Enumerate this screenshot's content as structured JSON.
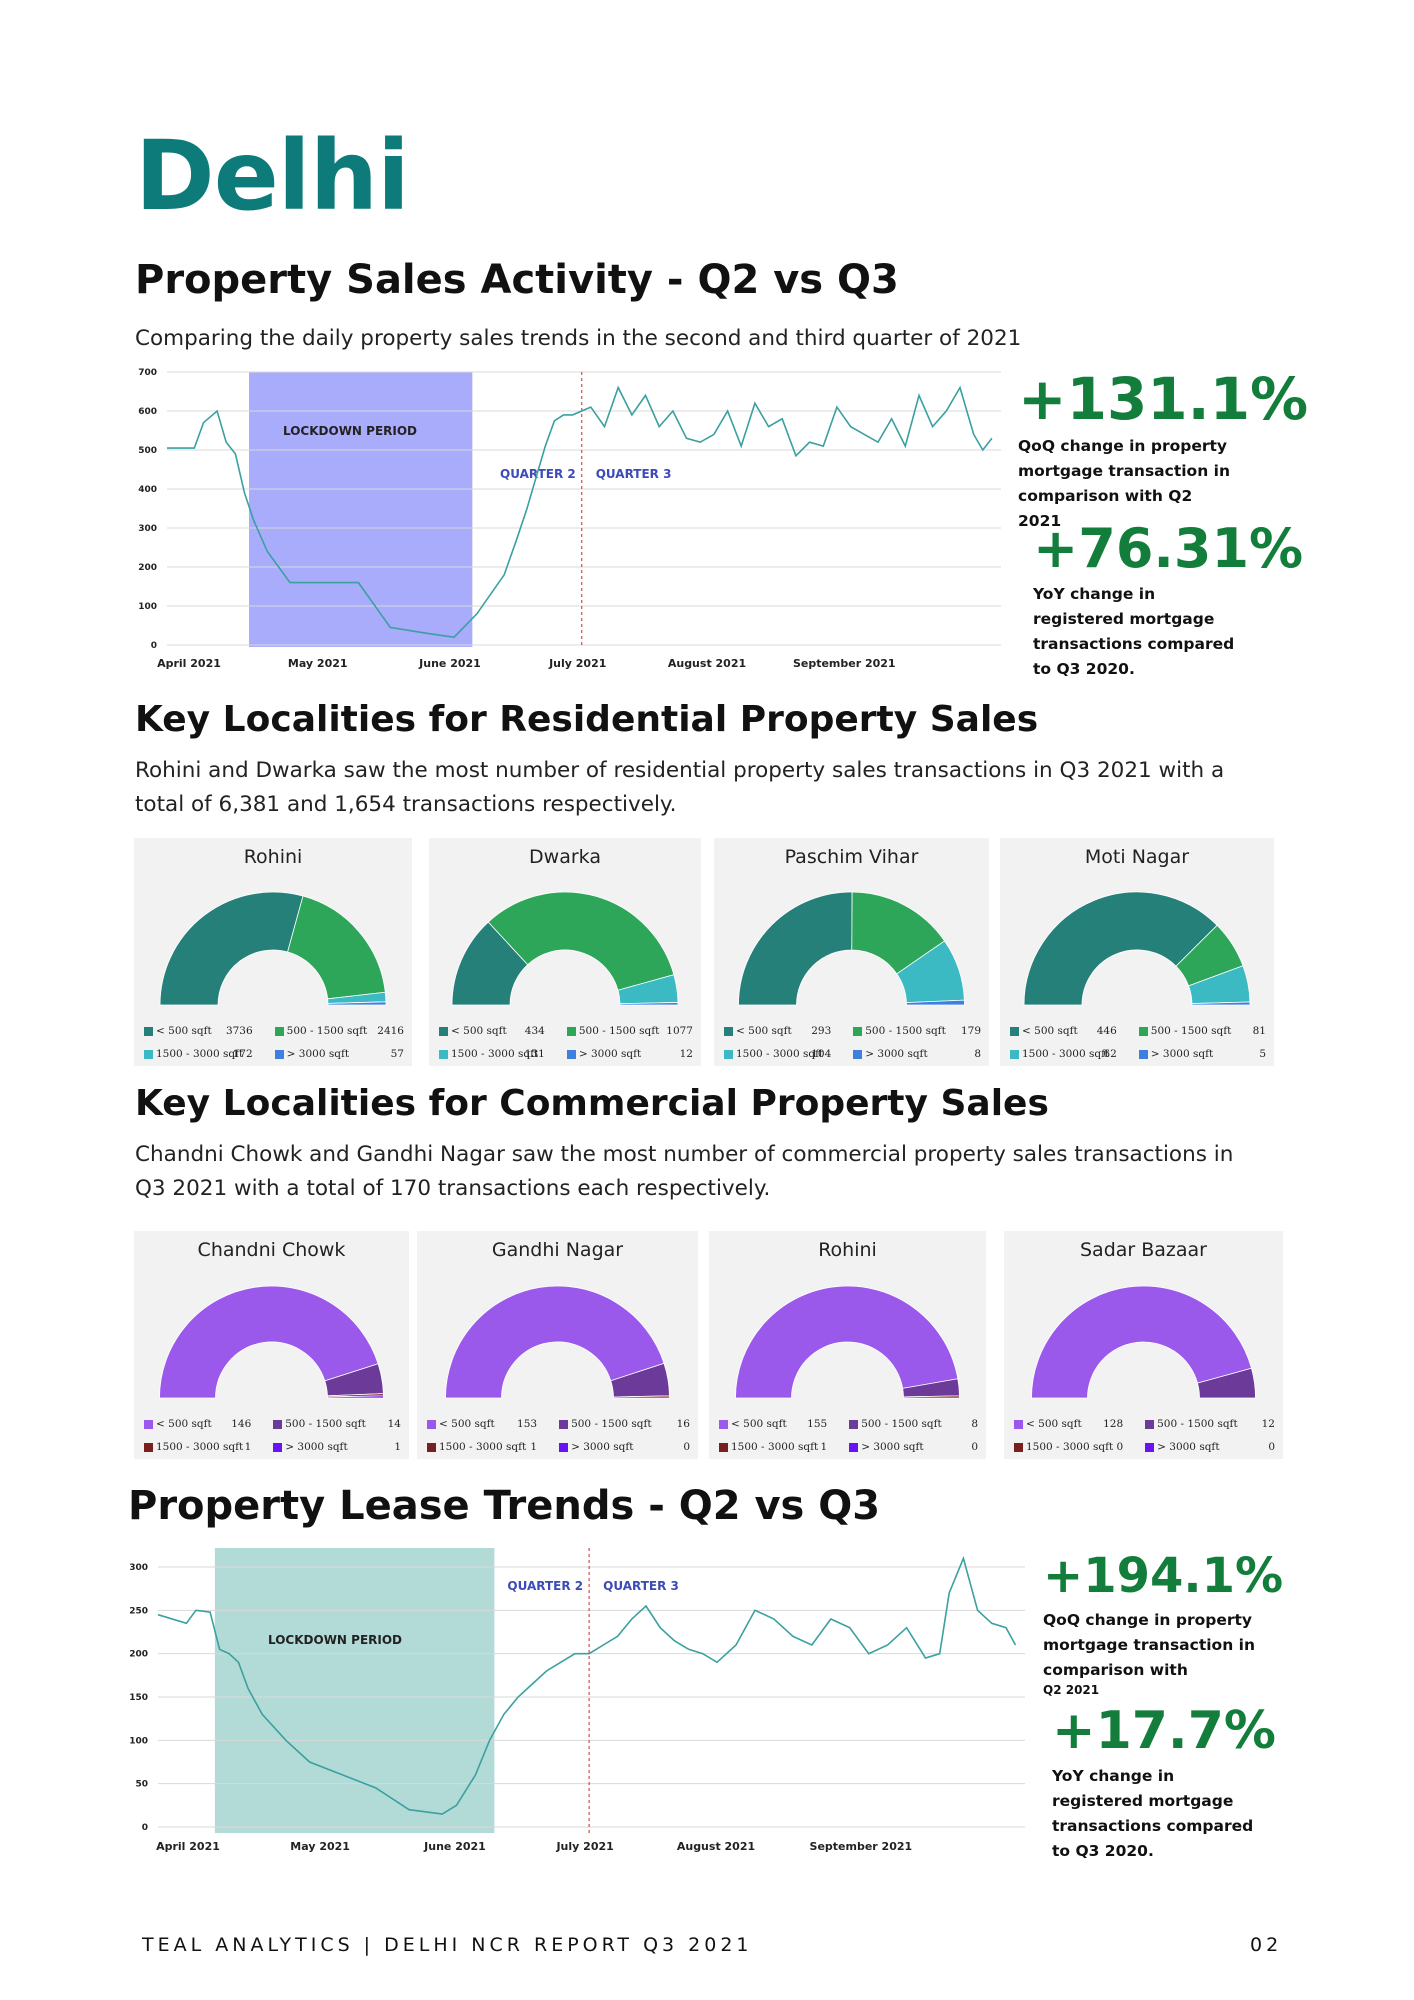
{
  "page": {
    "city": "Delhi",
    "footer_left": "TEAL ANALYTICS | DELHI NCR REPORT Q3 2021",
    "footer_right": "02"
  },
  "sales": {
    "heading": "Property Sales Activity - Q2 vs Q3",
    "subtitle": "Comparing the daily property sales trends in the second and third quarter of 2021",
    "stat1": {
      "value": "+131.1%",
      "text": "QoQ change in property mortgage transaction in comparison with Q2 2021"
    },
    "stat2": {
      "value": "+76.31%",
      "text": "YoY change in registered mortgage transactions compared to Q3 2020."
    }
  },
  "residential": {
    "heading": "Key Localities for Residential Property Sales",
    "text": "Rohini and Dwarka saw the most number of residential property sales transactions in Q3 2021 with a total of 6,381 and 1,654 transactions respectively."
  },
  "commercial": {
    "heading": "Key Localities for Commercial Property Sales",
    "text": "Chandni Chowk and Gandhi Nagar saw the most number of commercial property sales transactions in Q3 2021 with a total of 170 transactions each respectively."
  },
  "lease": {
    "heading": "Property Lease Trends - Q2 vs Q3",
    "stat1": {
      "value": "+194.1%",
      "text": "QoQ change in property mortgage transaction in comparison with",
      "text_small": "Q2 2021"
    },
    "stat2": {
      "value": "+17.7%",
      "text": "YoY change in registered mortgage transactions compared to Q3 2020."
    }
  },
  "legend_labels": {
    "a": "< 500 sqft",
    "b": "500 - 1500 sqft",
    "c": "1500 - 3000 sqft",
    "d": "> 3000 sqft"
  },
  "colors": {
    "teal_title": "#0d7b7a",
    "stat_green": "#137d3b",
    "res": [
      "#25807a",
      "#2ea65a",
      "#3bbac4",
      "#3f7fe0"
    ],
    "com": [
      "#9b59ec",
      "#6c3a99",
      "#7a1f1f",
      "#6a13f2"
    ],
    "sales_line": "#3aa0a0",
    "sales_lockdown": "#a9abfb",
    "lease_lockdown": "#b2dbd7"
  },
  "chart_data": [
    {
      "type": "line",
      "title": "",
      "x_tick_labels": [
        "April 2021",
        "May  2021",
        "June 2021",
        "July 2021",
        "August 2021",
        "September 2021"
      ],
      "ylim": [
        0,
        700
      ],
      "y_ticks": [
        0,
        100,
        200,
        300,
        400,
        500,
        600,
        700
      ],
      "annotations": [
        "LOCKDOWN PERIOD",
        "QUARTER 2",
        "QUARTER 3"
      ],
      "shaded_period": {
        "label": "LOCKDOWN PERIOD",
        "start": "2021-04-19",
        "end": "2021-06-07"
      },
      "quarter_divider": "2021-07-01",
      "series": [
        {
          "x": [
            "2021-04-01",
            "2021-04-07",
            "2021-04-09",
            "2021-04-12",
            "2021-04-14",
            "2021-04-16",
            "2021-04-18",
            "2021-04-20",
            "2021-04-23",
            "2021-04-28",
            "2021-05-03",
            "2021-05-07",
            "2021-05-13",
            "2021-05-20",
            "2021-05-28",
            "2021-05-31",
            "2021-06-03",
            "2021-06-08",
            "2021-06-14",
            "2021-06-17",
            "2021-06-19",
            "2021-06-21",
            "2021-06-23",
            "2021-06-25",
            "2021-06-27",
            "2021-06-29",
            "2021-07-01",
            "2021-07-03",
            "2021-07-06",
            "2021-07-09",
            "2021-07-12",
            "2021-07-15",
            "2021-07-18",
            "2021-07-21",
            "2021-07-24",
            "2021-07-27",
            "2021-07-30",
            "2021-08-02",
            "2021-08-05",
            "2021-08-08",
            "2021-08-11",
            "2021-08-14",
            "2021-08-17",
            "2021-08-20",
            "2021-08-23",
            "2021-08-26",
            "2021-08-29",
            "2021-09-01",
            "2021-09-04",
            "2021-09-07",
            "2021-09-10",
            "2021-09-13",
            "2021-09-16",
            "2021-09-19",
            "2021-09-22",
            "2021-09-25",
            "2021-09-27",
            "2021-09-29"
          ],
          "y": [
            505,
            505,
            570,
            600,
            520,
            490,
            390,
            320,
            240,
            160,
            160,
            160,
            160,
            45,
            30,
            25,
            20,
            80,
            180,
            280,
            350,
            430,
            510,
            575,
            590,
            590,
            600,
            610,
            560,
            660,
            590,
            640,
            560,
            600,
            530,
            520,
            540,
            600,
            510,
            620,
            560,
            580,
            485,
            520,
            510,
            610,
            560,
            540,
            520,
            580,
            510,
            640,
            560,
            600,
            660,
            540,
            500,
            530
          ]
        }
      ]
    },
    {
      "type": "line",
      "title": "",
      "x_tick_labels": [
        "April 2021",
        "May 2021",
        "June 2021",
        "July 2021",
        "August 2021",
        "September 2021"
      ],
      "ylim": [
        0,
        300
      ],
      "y_ticks": [
        0,
        50,
        100,
        150,
        200,
        250,
        300
      ],
      "annotations": [
        "LOCKDOWN PERIOD",
        "QUARTER 2",
        "QUARTER 3"
      ],
      "shaded_period": {
        "label": "LOCKDOWN PERIOD",
        "start": "2021-04-13",
        "end": "2021-06-11"
      },
      "quarter_divider": "2021-07-01",
      "series": [
        {
          "x": [
            "2021-04-01",
            "2021-04-07",
            "2021-04-09",
            "2021-04-12",
            "2021-04-14",
            "2021-04-16",
            "2021-04-18",
            "2021-04-20",
            "2021-04-23",
            "2021-04-28",
            "2021-05-03",
            "2021-05-10",
            "2021-05-17",
            "2021-05-24",
            "2021-05-31",
            "2021-06-03",
            "2021-06-07",
            "2021-06-10",
            "2021-06-13",
            "2021-06-16",
            "2021-06-19",
            "2021-06-22",
            "2021-06-25",
            "2021-06-28",
            "2021-07-01",
            "2021-07-04",
            "2021-07-07",
            "2021-07-10",
            "2021-07-13",
            "2021-07-16",
            "2021-07-19",
            "2021-07-22",
            "2021-07-25",
            "2021-07-28",
            "2021-08-01",
            "2021-08-05",
            "2021-08-09",
            "2021-08-13",
            "2021-08-17",
            "2021-08-21",
            "2021-08-25",
            "2021-08-29",
            "2021-09-02",
            "2021-09-06",
            "2021-09-10",
            "2021-09-13",
            "2021-09-15",
            "2021-09-18",
            "2021-09-21",
            "2021-09-24",
            "2021-09-27",
            "2021-09-29"
          ],
          "y": [
            245,
            235,
            250,
            248,
            205,
            200,
            190,
            160,
            130,
            100,
            75,
            60,
            45,
            20,
            15,
            25,
            60,
            100,
            130,
            150,
            165,
            180,
            190,
            200,
            200,
            210,
            220,
            240,
            255,
            230,
            215,
            205,
            200,
            190,
            210,
            250,
            240,
            220,
            210,
            240,
            230,
            200,
            210,
            230,
            195,
            200,
            270,
            310,
            250,
            235,
            230,
            210
          ]
        }
      ]
    },
    {
      "type": "pie",
      "title": "Rohini",
      "categories": [
        "< 500 sqft",
        "500 - 1500 sqft",
        "1500 - 3000 sqft",
        "> 3000 sqft"
      ],
      "values": [
        3736,
        2416,
        172,
        57
      ]
    },
    {
      "type": "pie",
      "title": "Dwarka",
      "categories": [
        "< 500 sqft",
        "500 - 1500 sqft",
        "1500 - 3000 sqft",
        "> 3000 sqft"
      ],
      "values": [
        434,
        1077,
        131,
        12
      ]
    },
    {
      "type": "pie",
      "title": "Paschim Vihar",
      "categories": [
        "< 500 sqft",
        "500 - 1500 sqft",
        "1500 - 3000 sqft",
        "> 3000 sqft"
      ],
      "values": [
        293,
        179,
        104,
        8
      ]
    },
    {
      "type": "pie",
      "title": "Moti Nagar",
      "categories": [
        "< 500 sqft",
        "500 - 1500 sqft",
        "1500 - 3000 sqft",
        "> 3000 sqft"
      ],
      "values": [
        446,
        81,
        62,
        5
      ]
    },
    {
      "type": "pie",
      "title": "Chandni Chowk",
      "categories": [
        "< 500 sqft",
        "500 - 1500 sqft",
        "1500 - 3000 sqft",
        "> 3000 sqft"
      ],
      "values": [
        146,
        14,
        1,
        1
      ]
    },
    {
      "type": "pie",
      "title": "Gandhi Nagar",
      "categories": [
        "< 500 sqft",
        "500 - 1500 sqft",
        "1500 - 3000 sqft",
        "> 3000 sqft"
      ],
      "values": [
        153,
        16,
        1,
        0
      ]
    },
    {
      "type": "pie",
      "title": "Rohini",
      "categories": [
        "< 500 sqft",
        "500 - 1500 sqft",
        "1500 - 3000 sqft",
        "> 3000 sqft"
      ],
      "values": [
        155,
        8,
        1,
        0
      ]
    },
    {
      "type": "pie",
      "title": "Sadar Bazaar",
      "categories": [
        "< 500 sqft",
        "500 - 1500 sqft",
        "1500 - 3000 sqft",
        "> 3000 sqft"
      ],
      "values": [
        128,
        12,
        0,
        0
      ]
    }
  ]
}
